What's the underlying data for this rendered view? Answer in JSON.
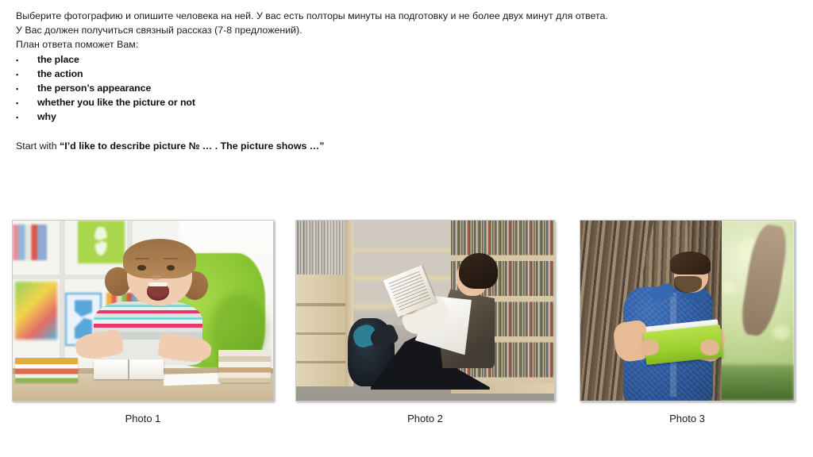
{
  "slide": {
    "background_color": "#ffffff",
    "text_color": "#1a1a1a"
  },
  "instructions": {
    "lines": [
      "Выберите фотографию и опишите человека на ней. У вас есть полторы минуты на подготовку и не более двух минут для ответа.",
      "У Вас должен получиться связный рассказ (7-8 предложений).",
      "План ответа поможет Вам:"
    ]
  },
  "plan": {
    "bullet_glyph": "▪",
    "items": [
      {
        "label": "the place"
      },
      {
        "label": "the action"
      },
      {
        "label": "the person’s appearance"
      },
      {
        "label": "whether you like the picture or not"
      },
      {
        "label": "why"
      }
    ]
  },
  "start_with": {
    "prefix": "Start with ",
    "open_quote": "“",
    "phrase": "I’d like to describe picture № … . The picture shows …",
    "close_quote": "”"
  },
  "photos": [
    {
      "caption": "Photo 1",
      "alt": "A little girl with pigtails sitting at a desk with an open book and stacks of books, a bright green chair behind her",
      "accent_color": "#8ec934"
    },
    {
      "caption": "Photo 2",
      "alt": "A teenage boy in a vest and white shirt sitting on the floor of a library aisle reading a book, with a backpack beside him",
      "accent_color": "#d0c09c"
    },
    {
      "caption": "Photo 3",
      "alt": "A young man in a blue shirt leaning against a tree trunk outdoors reading a green book",
      "accent_color": "#9ed232"
    }
  ]
}
